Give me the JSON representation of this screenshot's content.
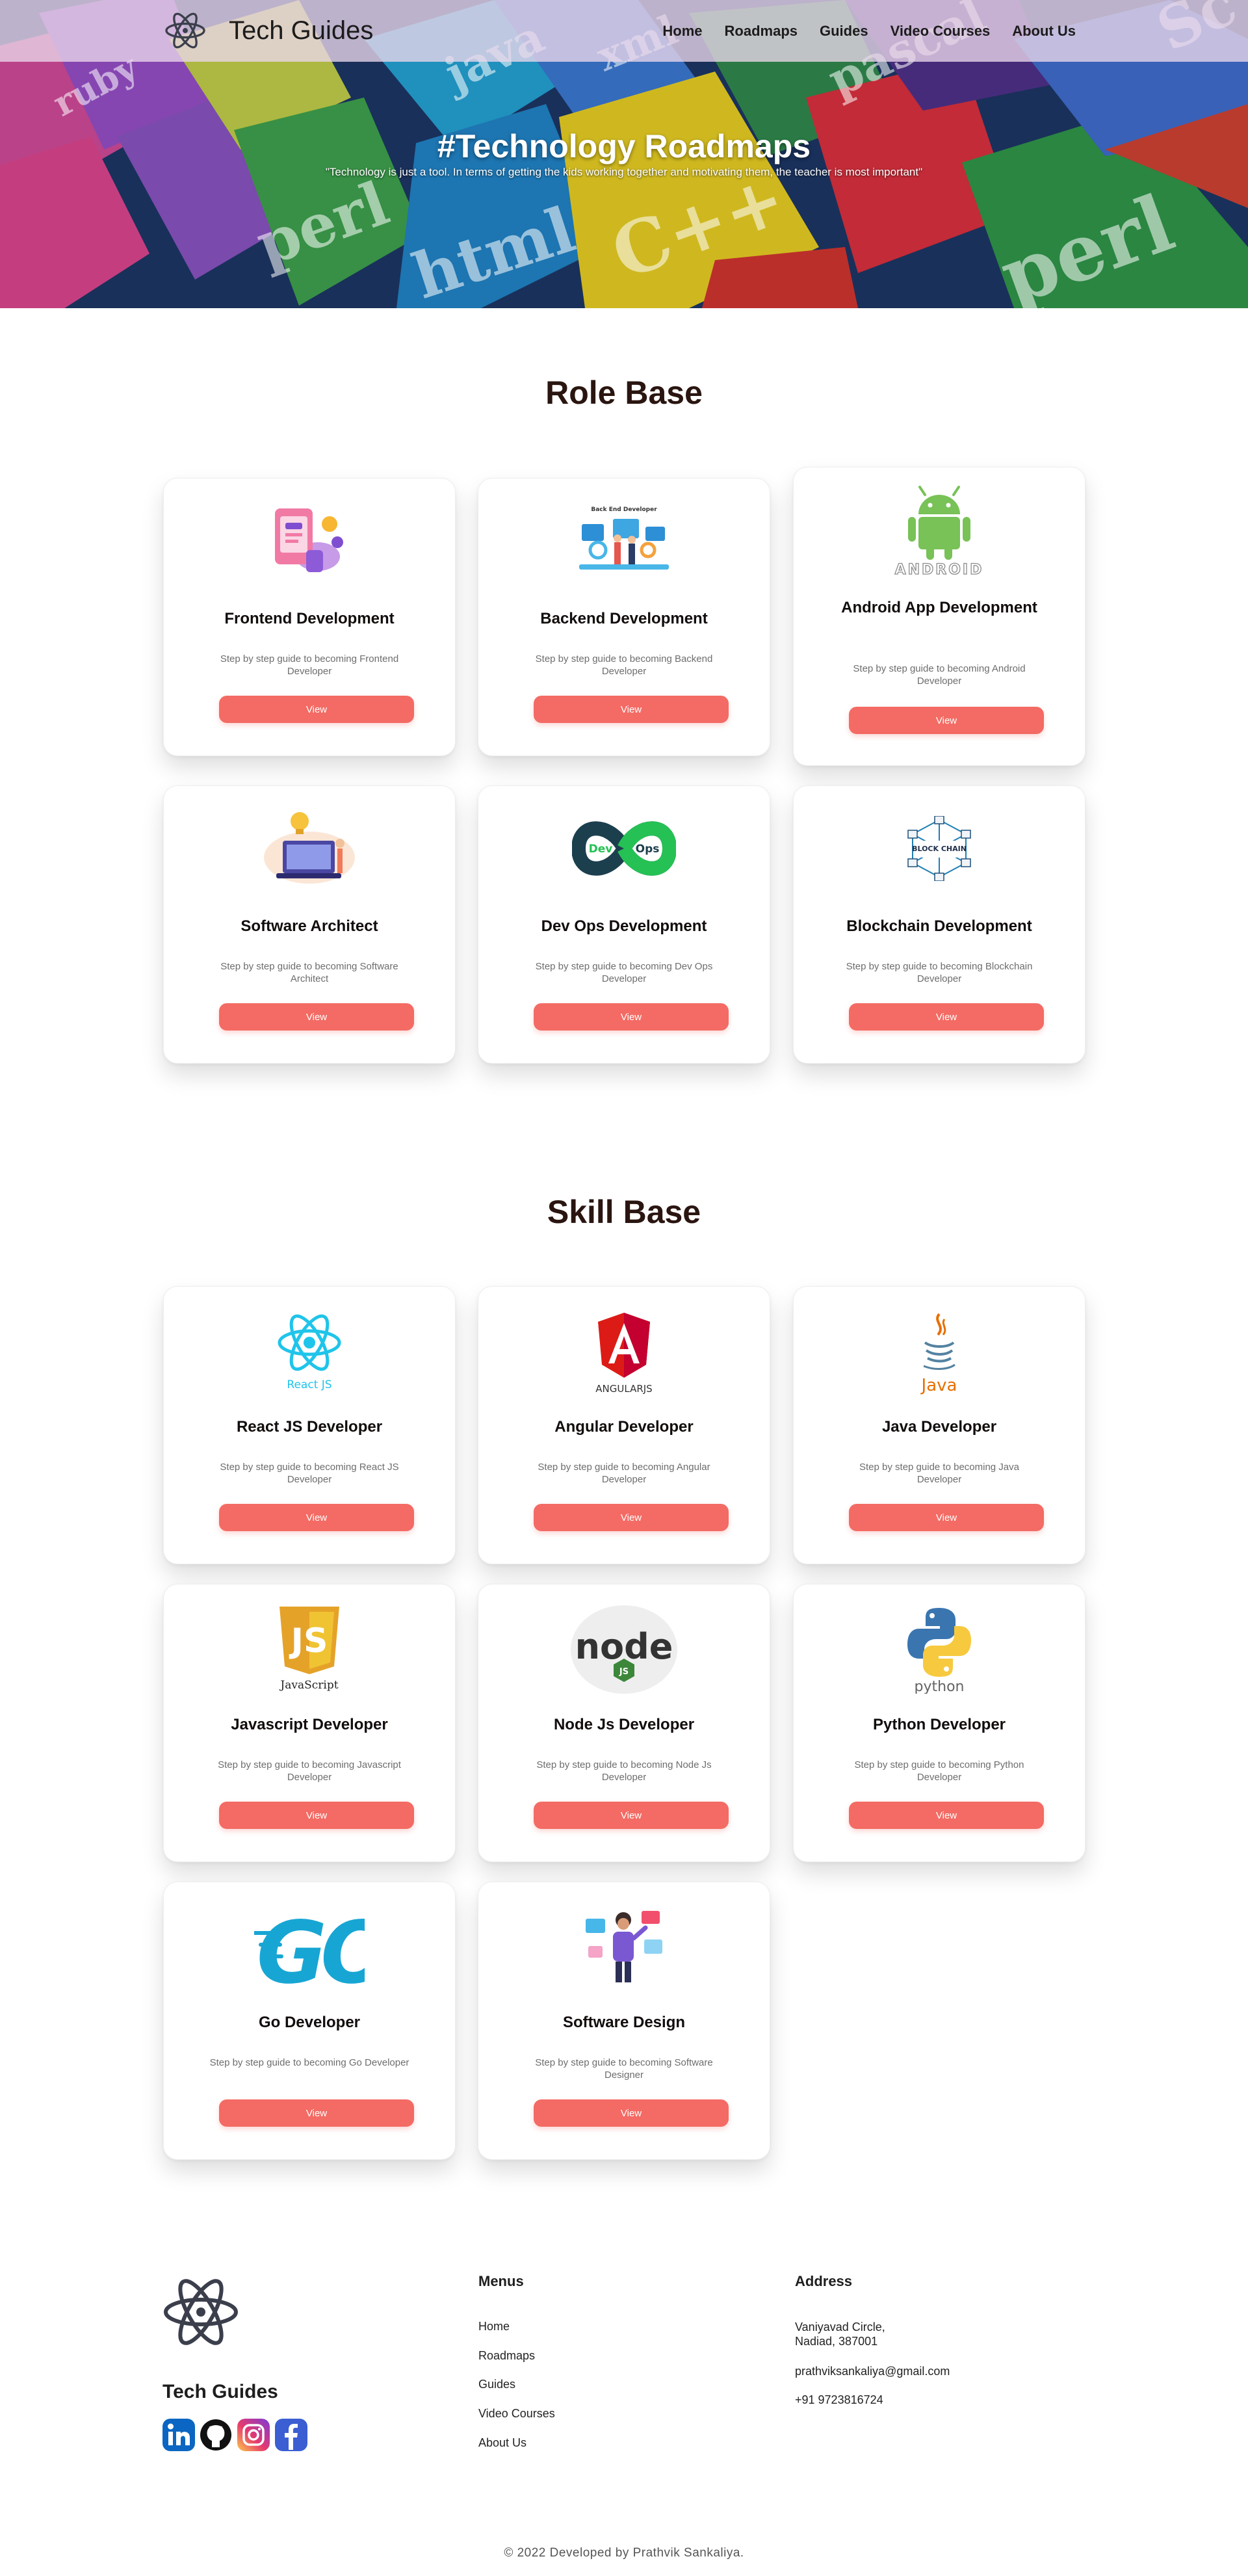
{
  "header": {
    "brand": "Tech Guides",
    "menu": [
      "Home",
      "Roadmaps",
      "Guides",
      "Video Courses",
      "About Us"
    ]
  },
  "hero": {
    "title": "#Technology Roadmaps",
    "quote": "\"Technology is just a tool. In terms of getting the kids working together and motivating them, the teacher is most important\"",
    "tile_labels": [
      "ruby",
      "java",
      "xml",
      "html",
      "C++",
      "perl",
      "perl",
      "pascal",
      "Sc"
    ]
  },
  "role_base": {
    "title": "Role Base",
    "cards": [
      {
        "title": "Frontend Development",
        "desc": "Step by step guide to becoming Frontend Developer",
        "button": "View",
        "icon": "frontend-illustration-icon"
      },
      {
        "title": "Backend Development",
        "desc": "Step by step guide to becoming Backend Developer",
        "button": "View",
        "icon": "backend-illustration-icon",
        "icon_caption": "Back End Developer"
      },
      {
        "title": "Android App Development",
        "desc": "Step by step guide to becoming Android Developer",
        "button": "View",
        "icon": "android-logo-icon",
        "icon_caption": "ANDROID"
      },
      {
        "title": "Software Architect",
        "desc": "Step by step guide to becoming Software Architect",
        "button": "View",
        "icon": "software-architect-illustration-icon"
      },
      {
        "title": "Dev Ops Development",
        "desc": "Step by step guide to becoming Dev Ops Developer",
        "button": "View",
        "icon": "devops-infinity-icon",
        "icon_labels": [
          "Dev",
          "Ops"
        ]
      },
      {
        "title": "Blockchain Development",
        "desc": "Step by step guide to becoming Blockchain Developer",
        "button": "View",
        "icon": "blockchain-icon",
        "icon_caption": "BLOCK CHAIN"
      }
    ]
  },
  "skill_base": {
    "title": "Skill Base",
    "cards": [
      {
        "title": "React JS Developer",
        "desc": "Step by step guide to becoming React JS Developer",
        "button": "View",
        "icon": "react-logo-icon",
        "icon_caption": "React JS"
      },
      {
        "title": "Angular Developer",
        "desc": "Step by step guide to becoming Angular Developer",
        "button": "View",
        "icon": "angular-logo-icon",
        "icon_caption": "ANGULARJS"
      },
      {
        "title": "Java Developer",
        "desc": "Step by step guide to becoming Java Developer",
        "button": "View",
        "icon": "java-logo-icon",
        "icon_caption": "Java"
      },
      {
        "title": "Javascript Developer",
        "desc": "Step by step guide to becoming Javascript Developer",
        "button": "View",
        "icon": "javascript-logo-icon",
        "icon_caption": "JavaScript"
      },
      {
        "title": "Node Js Developer",
        "desc": "Step by step guide to becoming Node Js Developer",
        "button": "View",
        "icon": "nodejs-logo-icon",
        "icon_caption": "node"
      },
      {
        "title": "Python Developer",
        "desc": "Step by step guide to becoming Python Developer",
        "button": "View",
        "icon": "python-logo-icon",
        "icon_caption": "python"
      },
      {
        "title": "Go Developer",
        "desc": "Step by step guide to becoming Go Developer",
        "button": "View",
        "icon": "go-logo-icon",
        "icon_caption": "GO"
      },
      {
        "title": "Software Design",
        "desc": "Step by step guide to becoming Software Designer",
        "button": "View",
        "icon": "software-design-illustration-icon"
      }
    ]
  },
  "footer": {
    "brand": "Tech Guides",
    "social": [
      "linkedin-icon",
      "github-icon",
      "instagram-icon",
      "facebook-icon"
    ],
    "menus_title": "Menus",
    "menus": [
      "Home",
      "Roadmaps",
      "Guides",
      "Video Courses",
      "About Us"
    ],
    "address_title": "Address",
    "address_line1": "Vaniyavad Circle,",
    "address_line2": "Nadiad, 387001",
    "email": "prathviksankaliya@gmail.com",
    "phone": "+91 9723816724",
    "copyright": "© 2022 Developed by Prathvik Sankaliya."
  },
  "colors": {
    "accent_button": "#f36b64",
    "nav_background": "#ebd7eb",
    "heading_text": "#2a1510"
  }
}
